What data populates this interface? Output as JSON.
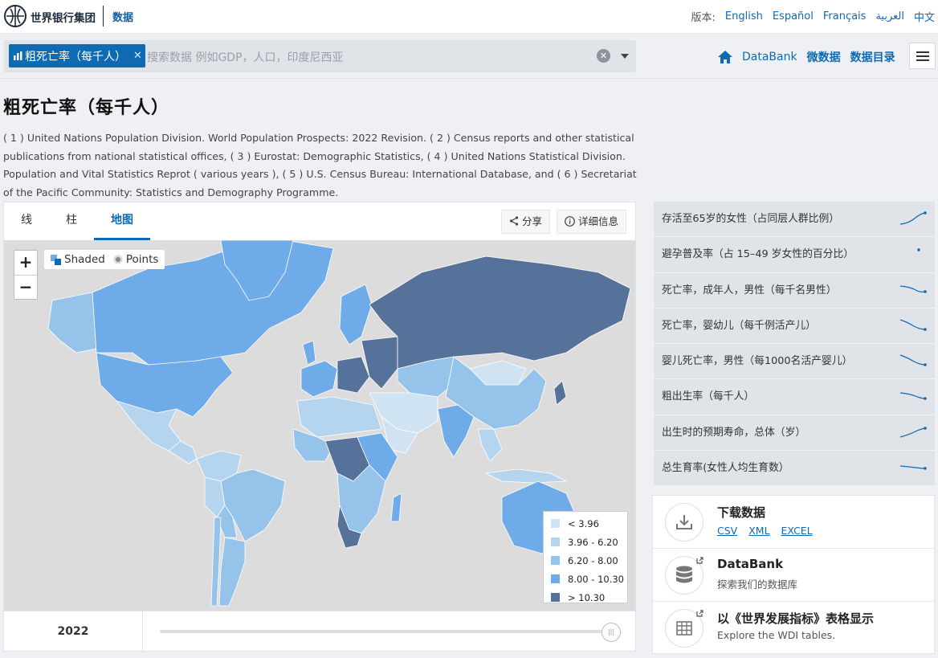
{
  "brand": {
    "name": "世界银行集团",
    "section": "数据"
  },
  "languages": {
    "label": "版本:",
    "items": [
      "English",
      "Español",
      "Français",
      "العربية",
      "中文"
    ]
  },
  "search": {
    "chip_label": "粗死亡率（每千人）",
    "placeholder": "搜索数据 例如GDP，人口，印度尼西亚"
  },
  "nav": {
    "items": [
      "DataBank",
      "微数据",
      "数据目录"
    ]
  },
  "indicator": {
    "title": "粗死亡率（每千人）",
    "source": "( 1 ) United Nations Population Division. World Population Prospects: 2022 Revision. ( 2 ) Census reports and other statistical publications from national statistical offices, ( 3 ) Eurostat: Demographic Statistics, ( 4 ) United Nations Statistical Division. Population and Vital Statistics Reprot ( various years ), ( 5 ) U.S. Census Bureau: International Database, and ( 6 ) Secretariat of the Pacific Community: Statistics and Demography Programme."
  },
  "chart_tabs": [
    "线",
    "柱",
    "地图"
  ],
  "active_tab": "地图",
  "actions": {
    "share": "分享",
    "details": "详细信息"
  },
  "map": {
    "modes": [
      "Shaded",
      "Points"
    ],
    "active_mode": "Shaded",
    "zoom_in": "+",
    "zoom_out": "−"
  },
  "colors": {
    "accent": "#0f6ab4",
    "lt396": "#cfe3f3",
    "r396_620": "#b5d5ef",
    "r620_800": "#95c3ea",
    "r800_1030": "#6fabe8",
    "gt1030": "#56729a",
    "no_data": "#dcdcdc"
  },
  "chart_data": {
    "type": "choropleth-map",
    "year": "2022",
    "legend": [
      {
        "label": "< 3.96",
        "color": "#cfe3f3"
      },
      {
        "label": "3.96 - 6.20",
        "color": "#b5d5ef"
      },
      {
        "label": "6.20 - 8.00",
        "color": "#95c3ea"
      },
      {
        "label": "8.00 - 10.30",
        "color": "#6fabe8"
      },
      {
        "label": "> 10.30",
        "color": "#56729a"
      }
    ],
    "legend_position": "bottom-right"
  },
  "related": [
    {
      "label": "存活至65岁的女性（占同层人群比例）",
      "trend": "up"
    },
    {
      "label": "避孕普及率（占 15–49 岁女性的百分比）",
      "trend": "point"
    },
    {
      "label": "死亡率，成年人，男性（每千名男性）",
      "trend": "down"
    },
    {
      "label": "死亡率，婴幼儿（每千例活产儿）",
      "trend": "down"
    },
    {
      "label": "婴儿死亡率，男性（每1000名活产婴儿）",
      "trend": "down"
    },
    {
      "label": "粗出生率（每千人）",
      "trend": "down"
    },
    {
      "label": "出生时的预期寿命，总体（岁）",
      "trend": "up"
    },
    {
      "label": "总生育率(女性人均生育数）",
      "trend": "down"
    }
  ],
  "downloads": {
    "title": "下载数据",
    "formats": [
      "CSV",
      "XML",
      "EXCEL"
    ],
    "databank_title": "DataBank",
    "databank_sub": "探索我们的数据库",
    "wdi_title": "以《世界发展指标》表格显示",
    "wdi_sub": "Explore the WDI tables."
  }
}
